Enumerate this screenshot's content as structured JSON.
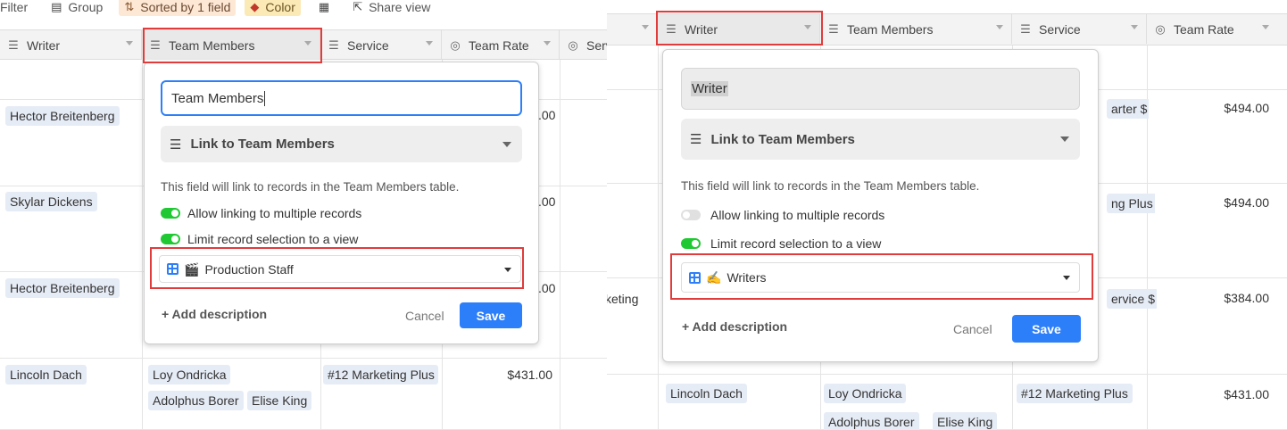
{
  "left": {
    "toolbar": {
      "filter": "Filter",
      "group": "Group",
      "sorted": "Sorted by 1 field",
      "color": "Color",
      "share": "Share view"
    },
    "headers": {
      "writer": "Writer",
      "team_members": "Team Members",
      "service": "Service",
      "team_rate": "Team Rate",
      "fifth": "Serv"
    },
    "rows": [
      {
        "writer": "Hector Breitenberg",
        "rate_fragment": ".00"
      },
      {
        "writer": "Skylar Dickens",
        "rate_fragment": ".00"
      },
      {
        "writer": "Hector Breitenberg",
        "rate_fragment": ".00"
      },
      {
        "writer": "Lincoln Dach",
        "members": [
          "Loy Ondricka",
          "Adolphus Borer",
          "Elise King"
        ],
        "service": "#12 Marketing Plus",
        "rate": "$431.00"
      }
    ],
    "popup": {
      "name_value": "Team Members",
      "type_label": "Link to Team Members",
      "description": "This field will link to records in the Team Members table.",
      "allow_multiple_label": "Allow linking to multiple records",
      "allow_multiple_on": true,
      "limit_view_label": "Limit record selection to a view",
      "limit_view_on": true,
      "view_emoji": "🎬",
      "view_name": "Production Staff",
      "add_description": "+ Add description",
      "cancel": "Cancel",
      "save": "Save"
    }
  },
  "right": {
    "headers": {
      "writer": "Writer",
      "team_members": "Team Members",
      "service": "Service",
      "team_rate": "Team Rate"
    },
    "rows": [
      {
        "service_fragment": "arter $",
        "rate": "$494.00"
      },
      {
        "service_fragment": "ng Plus",
        "rate": "$494.00"
      },
      {
        "writer_fragment": "keting",
        "service_fragment": "ervice $",
        "rate": "$384.00"
      },
      {
        "writer": "Lincoln Dach",
        "members": [
          "Loy Ondricka",
          "Adolphus Borer",
          "Elise King"
        ],
        "service": "#12 Marketing Plus",
        "rate": "$431.00"
      }
    ],
    "popup": {
      "name_value": "Writer",
      "type_label": "Link to Team Members",
      "description": "This field will link to records in the Team Members table.",
      "allow_multiple_label": "Allow linking to multiple records",
      "allow_multiple_on": false,
      "limit_view_label": "Limit record selection to a view",
      "limit_view_on": true,
      "view_emoji": "✍️",
      "view_name": "Writers",
      "add_description": "+ Add description",
      "cancel": "Cancel",
      "save": "Save"
    }
  },
  "colors": {
    "accent": "#2d7ff9",
    "toggle_on": "#20c933",
    "highlight": "#e03c3c",
    "chip": "#e6ecf6"
  }
}
